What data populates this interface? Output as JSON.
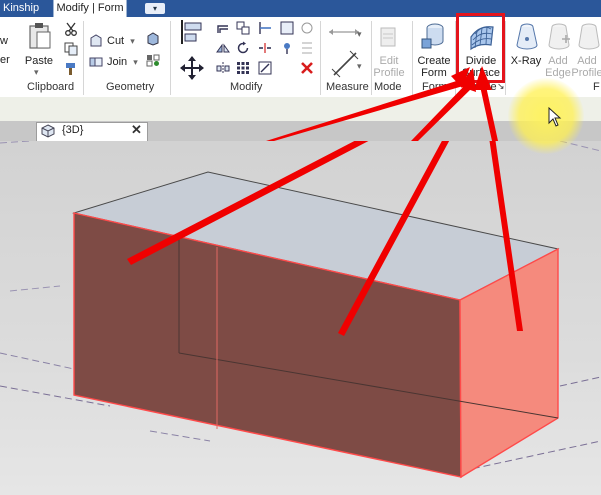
{
  "tabs": {
    "kinship": "Kinship",
    "modify_form": "Modify | Form",
    "quick_access_dropdown": "▾"
  },
  "ribbon": {
    "cut_label": "Cut",
    "join_label": "Join",
    "paste_label": "Paste",
    "partial_left_label": "er",
    "edit_profile_label": "Edit\nProfile",
    "create_form_label": "Create\nForm",
    "divide_surface_label": "Divide\nSurface",
    "xray_label": "X-Ray",
    "add_edge_label": "Add\nEdge",
    "add_profile_label": "Add\nProfile",
    "panels": {
      "clipboard": "Clipboard",
      "geometry": "Geometry",
      "modify": "Modify",
      "measure": "Measure",
      "mode": "Mode",
      "form": "Form",
      "divide": "Divide",
      "divide_expander": "↘",
      "form_element_partial": "F"
    }
  },
  "view_tab": {
    "label": "{3D}",
    "close": "✕"
  },
  "colors": {
    "ribbon_tab_bar": "#2b579a",
    "highlight_red": "#e4141c",
    "cursor_glow": "#fff35a",
    "box_front_face": "#7e4b45",
    "box_right_face": "#f58a7d",
    "box_top_face": "#c7cdd6",
    "box_edge": "#ff4a4a"
  }
}
